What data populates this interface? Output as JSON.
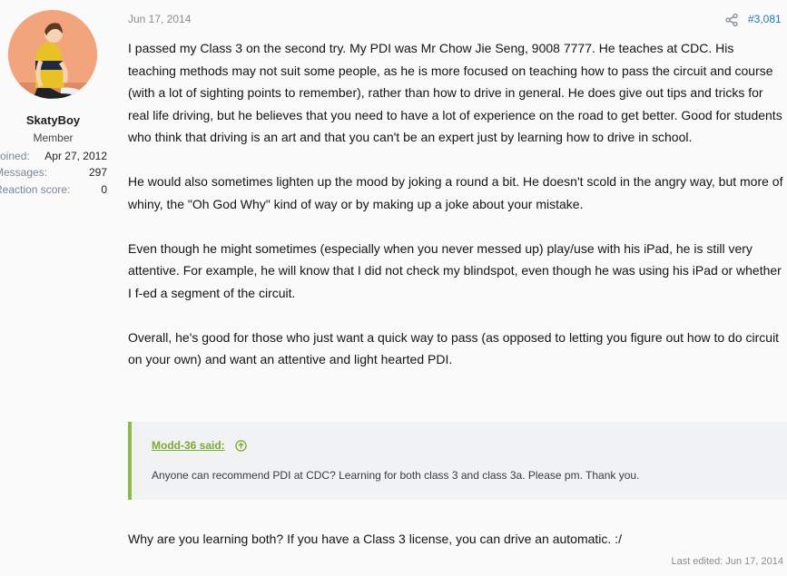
{
  "author": {
    "username": "SkatyBoy",
    "title": "Member",
    "stats": [
      {
        "label": "Joined:",
        "value": "Apr 27, 2012"
      },
      {
        "label": "Messages:",
        "value": "297"
      },
      {
        "label": "Reaction score:",
        "value": "0"
      }
    ]
  },
  "post": {
    "date": "Jun 17, 2014",
    "number": "#3,081",
    "share_icon": "share-icon",
    "paragraphs": [
      "I passed my Class 3 on the second try. My PDI was Mr Chow Jie Seng, 9008 7777. He teaches at CDC. His teaching methods may not suit some people, as he is more focused on teaching how to pass the circuit and course (with a lot of sighting points to remember), rather than how to drive in general. He does give out tips and tricks for real life driving, but he believes that you need to have a lot of experience on the road to get better. Good for students who think that driving is an art and that you can't be an expert just by learning how to drive in school.",
      "He would also sometimes lighten up the mood by joking a round a bit. He doesn't scold in the angry way, but more of whiny, the \"Oh God Why\" kind of way or by making up a joke about your mistake.",
      "Even though he might sometimes (especially when you never messed up) play/use with his iPad, he is still very attentive. For example, he will know that I did not check my blindspot, even though he was using his iPad or whether I f-ed a segment of the circuit.",
      "Overall, he's good for those who just want a quick way to pass (as opposed to letting you figure out how to do circuit on your own) and want an attentive and light hearted PDI."
    ],
    "quote": {
      "author_label": "Modd-36 said:",
      "text": "Anyone can recommend PDI at CDC? Learning for both class 3 and class 3a. Please pm. Thank you."
    },
    "reply": "Why are you learning both? If you have a Class 3 license, you can drive an automatic. :/",
    "last_edited": "Last edited: Jun 17, 2014"
  },
  "colors": {
    "link": "#2577b1",
    "quote_accent": "#8cbc47",
    "quote_bg": "#f1f2f4",
    "page_bg": "#fafafa"
  }
}
